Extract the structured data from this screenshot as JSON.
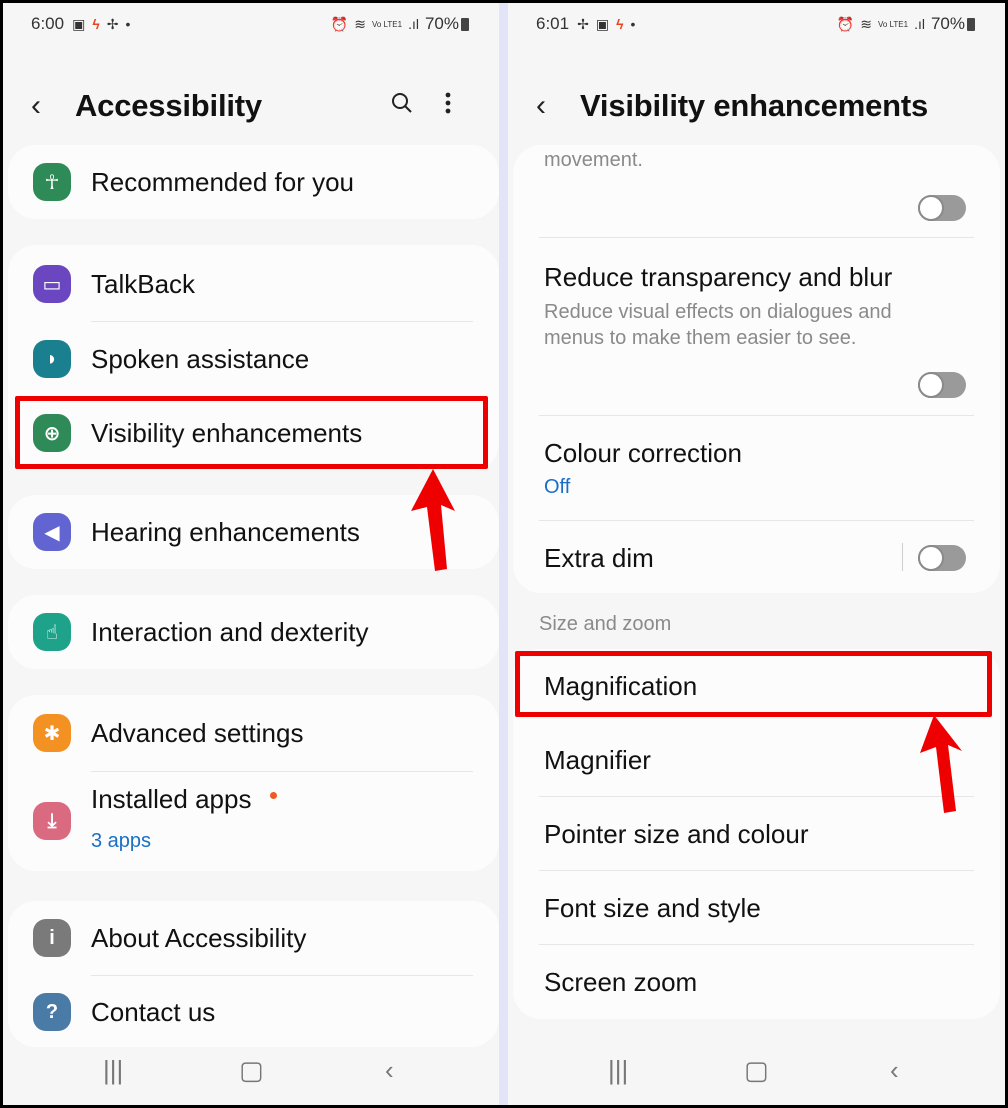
{
  "left_screen": {
    "status_bar": {
      "time": "6:00",
      "icons": [
        "gallery-icon",
        "flash-icon",
        "fan-icon",
        "dot-icon"
      ],
      "right_icons": [
        "alarm-icon",
        "wifi-icon",
        "volte-icon",
        "signal-icon"
      ],
      "battery": "70%"
    },
    "header": {
      "title": "Accessibility",
      "back_label": "‹",
      "search_label": "⌕",
      "more_label": "⋮"
    },
    "groups": [
      {
        "items": [
          {
            "label": "Recommended for you",
            "icon": "accessibility-person-icon",
            "color": "#2e8b57"
          }
        ]
      },
      {
        "items": [
          {
            "label": "TalkBack",
            "icon": "talkback-chat-icon",
            "color": "#6b46c1"
          },
          {
            "label": "Spoken assistance",
            "icon": "spoken-assistance-icon",
            "color": "#1a7f8e"
          },
          {
            "label": "Visibility enhancements",
            "icon": "zoom-in-icon",
            "color": "#2e8b57",
            "highlighted": true
          }
        ]
      },
      {
        "items": [
          {
            "label": "Hearing enhancements",
            "icon": "hearing-volume-icon",
            "color": "#6264d1"
          }
        ]
      },
      {
        "items": [
          {
            "label": "Interaction and dexterity",
            "icon": "touch-hand-icon",
            "color": "#1ea38a"
          }
        ]
      },
      {
        "items": [
          {
            "label": "Advanced settings",
            "icon": "gear-plus-icon",
            "color": "#f39222"
          },
          {
            "label": "Installed apps",
            "sublabel": "3 apps",
            "icon": "download-icon",
            "color": "#d96a80",
            "badge": true
          }
        ]
      },
      {
        "items": [
          {
            "label": "About Accessibility",
            "icon": "info-icon",
            "color": "#7a7a7a"
          },
          {
            "label": "Contact us",
            "icon": "help-question-icon",
            "color": "#4a7ba6"
          }
        ]
      }
    ],
    "nav": {
      "recents": "|||",
      "home": "▢",
      "back": "‹"
    }
  },
  "right_screen": {
    "status_bar": {
      "time": "6:01",
      "icons": [
        "fan-icon",
        "gallery-icon",
        "flash-icon",
        "dot-icon"
      ],
      "right_icons": [
        "alarm-icon",
        "wifi-icon",
        "volte-icon",
        "signal-icon"
      ],
      "battery": "70%"
    },
    "header": {
      "title": "Visibility enhancements",
      "back_label": "‹"
    },
    "items": [
      {
        "description_tail": "movement.",
        "toggle": false
      },
      {
        "label": "Reduce transparency and blur",
        "description": "Reduce visual effects on dialogues and menus to make them easier to see.",
        "toggle": false
      },
      {
        "label": "Colour correction",
        "sublabel": "Off"
      },
      {
        "label": "Extra dim",
        "toggle": false
      }
    ],
    "section_title": "Size and zoom",
    "size_zoom_items": [
      {
        "label": "Magnification",
        "highlighted": true
      },
      {
        "label": "Magnifier"
      },
      {
        "label": "Pointer size and colour"
      },
      {
        "label": "Font size and style"
      },
      {
        "label": "Screen zoom"
      }
    ],
    "nav": {
      "recents": "|||",
      "home": "▢",
      "back": "‹"
    }
  },
  "annotation_color": "#ee0000",
  "status_glyphs": {
    "gallery": "▣",
    "flash": "ϟ",
    "fan": "✢",
    "dot": "•",
    "alarm": "⏰",
    "wifi": "≋",
    "volte": "Vo LTE1",
    "signal": ".ıl"
  },
  "icon_glyphs": {
    "person": "☥",
    "chat": "▭",
    "speaker": "◗",
    "zoom": "⊕",
    "hearing": "◀",
    "hand": "☝",
    "gear": "✱",
    "download": "⤓",
    "info": "i",
    "help": "?"
  }
}
